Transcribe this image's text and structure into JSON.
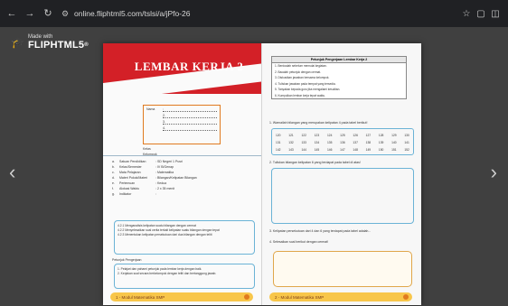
{
  "browser": {
    "url": "online.fliphtml5.com/tslsi/a/jPfo-26",
    "back_icon": "arrow-left-icon",
    "forward_icon": "arrow-right-icon",
    "reload_icon": "reload-icon",
    "site_info_icon": "tune-icon",
    "bookmark_icon": "star-icon",
    "extensions_icon": "puzzle-icon",
    "window_icon": "square-icon"
  },
  "viewer": {
    "logo_made": "Made with",
    "logo_brand": "FLIPHTML5",
    "logo_reg": "®",
    "prev_icon": "‹",
    "next_icon": "›"
  },
  "left_page": {
    "title": "LEMBAR KERJA 2",
    "identity": [
      {
        "k": "Nama",
        "v": ":"
      },
      {
        "k": "",
        "v": "2."
      },
      {
        "k": "",
        "v": "3."
      },
      {
        "k": "",
        "v": "4."
      }
    ],
    "identity_extra": [
      "Kelas",
      "Kelompok"
    ],
    "meta": [
      {
        "k": "Satuan Pendidikan",
        "v": ": SD Negeri 1 Pusri"
      },
      {
        "k": "Kelas/Semester",
        "v": ": IV B/Genap"
      },
      {
        "k": "Mata Pelajaran",
        "v": ": Matematika"
      },
      {
        "k": "Materi Pokok/Materi",
        "v": ": Bilangan/Kelipatan Bilangan"
      },
      {
        "k": "Pertemuan",
        "v": ": Kedua"
      },
      {
        "k": "Alokasi Waktu",
        "v": ": 2 x 35 menit"
      },
      {
        "k": "Indikator",
        "v": ":"
      }
    ],
    "tp": [
      "4.2.1 Menganalisis kelipatan suatu bilangan dengan cermat",
      "4.2.2 Menyelesaikan soal cerita terkait kelipatan suatu bilangan dengan tepat",
      "4.2.3 Menentukan kelipatan persekutuan dari dua bilangan dengan teliti"
    ],
    "section_label": "Petunjuk Pengerjaan",
    "petunjuk": [
      "1. Pelajari dan pahami petunjuk pada lembar kerja dengan baik.",
      "2. Kerjakan soal secara berkelompok dengan teliti dan bertanggung jawab."
    ],
    "footer": "1 - Modul Matematika SMP"
  },
  "right_page": {
    "table_header": "Petunjuk Pengerjaan Lembar Kerja 2",
    "table_items": [
      "1. Berdoalah sebelum memulai kegiatan.",
      "2. Bacalah petunjuk dengan cermat.",
      "3. Diskusikan jawaban bersama kelompok.",
      "4. Tuliskan jawaban pada tempat yang tersedia.",
      "5. Tanyakan kepada guru jika mengalami kesulitan.",
      "6. Kumpulkan lembar kerja tepat waktu."
    ],
    "q1": "1. Warnailah bilangan yang merupakan kelipatan 4 pada tabel berikut!",
    "numbers": [
      [
        "120",
        "121",
        "122",
        "123",
        "124",
        "125",
        "126",
        "127",
        "128",
        "129",
        "130"
      ],
      [
        "131",
        "132",
        "133",
        "134",
        "135",
        "136",
        "137",
        "138",
        "139",
        "140",
        "141"
      ],
      [
        "142",
        "143",
        "144",
        "145",
        "146",
        "147",
        "148",
        "149",
        "150",
        "151",
        "152"
      ]
    ],
    "q2": "2. Tuliskan bilangan kelipatan 6 yang terdapat pada tabel di atas!",
    "q3": "3. Kelipatan persekutuan dari 4 dan 6 yang terdapat pada tabel adalah...",
    "q4": "4. Selesaikan soal berikut dengan cermat!",
    "footer": "2 - Modul Matematika SMP"
  }
}
